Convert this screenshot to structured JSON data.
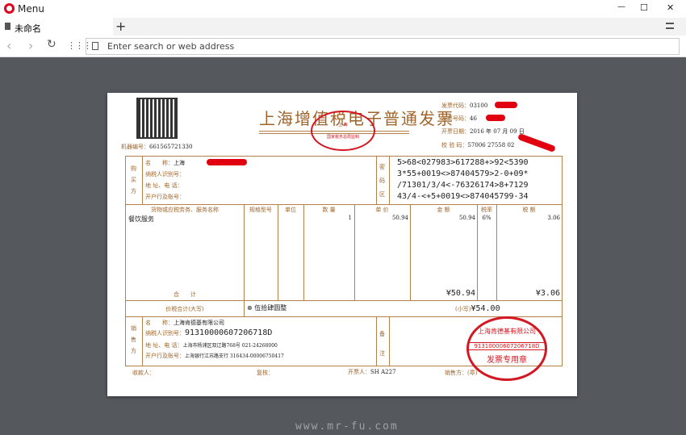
{
  "browser": {
    "menu_label": "Menu",
    "tab_title": "未命名",
    "new_tab": "+",
    "address_placeholder": "Enter search or web address",
    "win_min": "—",
    "win_max": "☐",
    "win_close": "✕"
  },
  "invoice": {
    "title": "上海增值税电子普通发票",
    "machine_no_label": "机器编号：",
    "machine_no": "661565721330",
    "code_label": "发票代码：",
    "code": "03100",
    "number_label": "发票号码：",
    "number": "46",
    "date_label": "开票日期：",
    "date": "2016 年 07 月 09 日",
    "check_label": "校 验 码：",
    "check": "57006 27558 02",
    "seal_text": "国家税务总局监制",
    "seal_city": "上 海",
    "buyer_label": "购买方",
    "buyer": {
      "name_label": "名　　称：",
      "name": "上海　　　　　限公司",
      "tax_label": "纳税人识别号：",
      "addr_label": "地 址、电 话：",
      "bank_label": "开户行及账号："
    },
    "cipher_label": "密码区",
    "cipher": [
      "5>68<027983>617288+>92<5390",
      "3*55+0019<>87404579>2-0+09*",
      "/71301/3/4<-76326174>8+7129",
      "43/4-<+5+0019<>874045799-34"
    ],
    "columns": [
      "货物或应税劳务、服务名称",
      "规格型号",
      "单位",
      "数 量",
      "单 价",
      "金 额",
      "税率",
      "税 额"
    ],
    "items": [
      {
        "name": "餐饮服务",
        "spec": "",
        "unit": "",
        "qty": "1",
        "price": "50.94",
        "amount": "50.94",
        "rate": "6%",
        "tax": "3.06"
      }
    ],
    "total_label": "合　　计",
    "total_amount": "¥50.94",
    "total_tax": "¥3.06",
    "grand_label": "价税合计(大写)",
    "grand_words": "伍拾肆圆整",
    "grand_small_label": "(小写)",
    "grand_small": "¥54.00",
    "seller_label": "销售方",
    "seller": {
      "name_label": "名　　称：",
      "name": "上海肯德基有限公司",
      "tax_label": "纳税人识别号：",
      "tax": "91310000607206718D",
      "addr_label": "地 址、电 话：",
      "addr": "上海市杨浦区双辽路768号 021-24268000",
      "bank_label": "开户行及账号：",
      "bank": "上海银行江苏路支行 316434-00006750417"
    },
    "remark_label": "备注",
    "stamp_name": "上海肯德基有限公司",
    "stamp_tax": "91310000607206718D",
    "stamp_use": "发票专用章",
    "payee_label": "收款人：",
    "reviewer_label": "复核：",
    "drawer_label": "开票人：",
    "drawer": "SH A227",
    "seller_sign_label": "销售方：(章)"
  },
  "watermark": "www.mr-fu.com",
  "colors": {
    "accent": "#a0642a",
    "stamp": "#d21822",
    "background": "#55595e"
  }
}
